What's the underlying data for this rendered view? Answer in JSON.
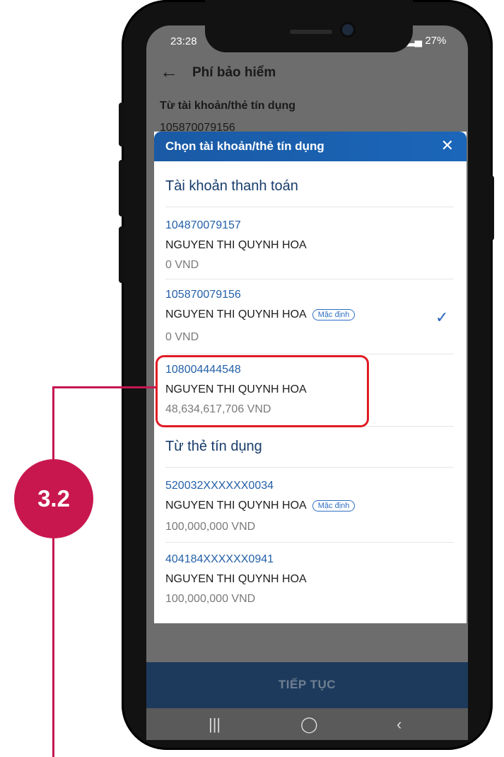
{
  "status_bar": {
    "time": "23:28",
    "battery": "27%"
  },
  "header": {
    "title": "Phí bảo hiểm"
  },
  "form": {
    "from_label": "Từ tài khoản/thẻ tín dụng",
    "from_value": "105870079156"
  },
  "modal": {
    "title": "Chọn tài khoản/thẻ tín dụng",
    "payment_section_title": "Tài khoản thanh toán",
    "accounts": [
      {
        "number": "104870079157",
        "name": "NGUYEN THI QUYNH HOA",
        "balance": "0 VND"
      },
      {
        "number": "105870079156",
        "name": "NGUYEN THI QUYNH HOA",
        "badge": "Mặc định",
        "balance": "0 VND"
      },
      {
        "number": "108004444548",
        "name": "NGUYEN THI QUYNH HOA",
        "balance": "48,634,617,706 VND"
      }
    ],
    "credit_section_title": "Từ thẻ tín dụng",
    "cards": [
      {
        "number": "520032XXXXXX0034",
        "name": "NGUYEN THI QUYNH HOA",
        "badge": "Mặc định",
        "balance": "100,000,000 VND"
      },
      {
        "number": "404184XXXXXX0941",
        "name": "NGUYEN THI QUYNH HOA",
        "balance": "100,000,000 VND"
      }
    ]
  },
  "footer": {
    "continue_label": "TIẾP TỤC"
  },
  "annotation": {
    "step": "3.2"
  },
  "colors": {
    "accent": "#1b66b9",
    "highlight": "#e01b24",
    "step_badge": "#c8174e"
  }
}
